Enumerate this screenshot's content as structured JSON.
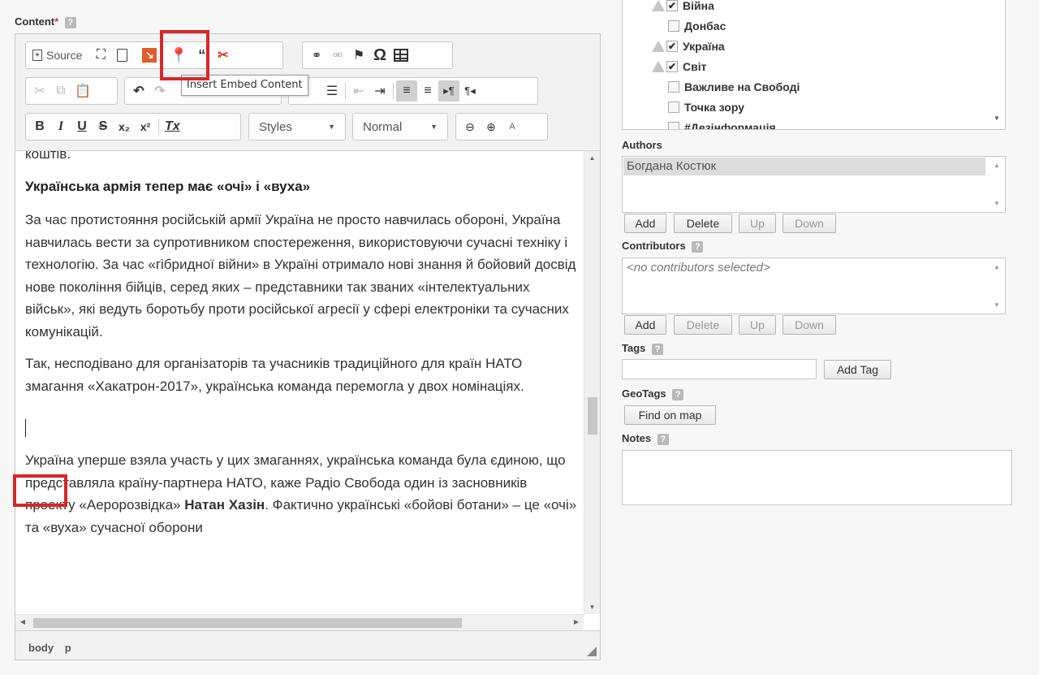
{
  "content": {
    "label": "Content",
    "required_mark": "*",
    "help": "?"
  },
  "toolbar": {
    "source_label": "Source",
    "styles_label": "Styles",
    "format_label": "Normal",
    "tooltip": "Insert Embed Content",
    "quote_glyph": "“",
    "bold": "B",
    "italic": "I",
    "underline": "U",
    "strike": "S",
    "subscript": "x₂",
    "superscript": "x²",
    "clear_format": "Tx",
    "special_char": "Ω"
  },
  "editor": {
    "top_fragment": "коштів.",
    "heading": "Українська армія тепер має «очі» і «вуха»",
    "para1": "За час протистояння російській армії Україна не просто навчилась обороні, Україна навчилась вести за супротивником спостереження, використовуючи сучасні техніку і технологію. За час «гібридної війни» в Україні отримало нові знання й бойовий досвід нове покоління бійців, серед яких – представники так званих «інтелектуальних військ», які ведуть боротьбу проти російської агресії у сфері електроніки та сучасних комунікацій.",
    "para2": "Так, несподівано для організаторів та учасників традиційного для країн НАТО змагання «Хакатрон-2017», українська команда перемогла у двох номінаціях.",
    "para3_before": "Україна уперше взяла участь у цих змаганнях, українська команда була єдиною, що представляла країну-партнера НАТО, каже Радіо Свобода один із засновників проекту «Аеророзвідка» ",
    "para3_bold": "Натан Хазін",
    "para3_after": ". Фактично українські «бойові ботани» – це «очі» та «вуха» сучасної оборони"
  },
  "statusbar": {
    "path": [
      "body",
      "p"
    ]
  },
  "categories": [
    {
      "label": "Війна",
      "checked": true,
      "warn": true
    },
    {
      "label": "Донбас",
      "checked": false,
      "warn": false
    },
    {
      "label": "Україна",
      "checked": true,
      "warn": true
    },
    {
      "label": "Світ",
      "checked": true,
      "warn": true
    },
    {
      "label": "Важливе на Свободі",
      "checked": false,
      "warn": false
    },
    {
      "label": "Точка зору",
      "checked": false,
      "warn": false
    },
    {
      "label": "#Дезінформація",
      "checked": false,
      "warn": false
    }
  ],
  "authors": {
    "label": "Authors",
    "selected": "Богдана Костюк",
    "buttons": {
      "add": "Add",
      "delete": "Delete",
      "up": "Up",
      "down": "Down"
    }
  },
  "contributors": {
    "label": "Contributors",
    "help": "?",
    "placeholder": "<no contributors selected>",
    "buttons": {
      "add": "Add",
      "delete": "Delete",
      "up": "Up",
      "down": "Down"
    }
  },
  "tags": {
    "label": "Tags",
    "help": "?",
    "value": "",
    "add_button": "Add Tag"
  },
  "geotags": {
    "label": "GeoTags",
    "help": "?",
    "find_button": "Find on map"
  },
  "notes": {
    "label": "Notes",
    "help": "?",
    "value": ""
  },
  "colors": {
    "highlight": "#d62828"
  }
}
